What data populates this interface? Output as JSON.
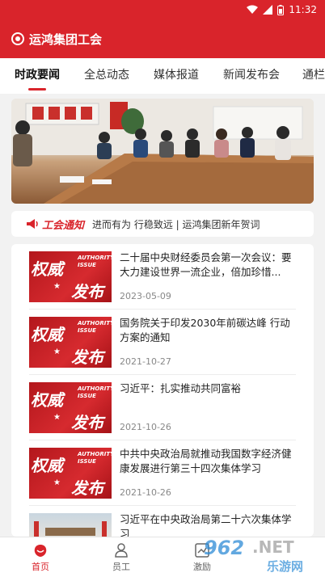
{
  "status": {
    "time": "11:32"
  },
  "header": {
    "title": "运鸿集团工会"
  },
  "tabs": [
    {
      "label": "时政要闻",
      "active": true
    },
    {
      "label": "全总动态",
      "active": false
    },
    {
      "label": "媒体报道",
      "active": false
    },
    {
      "label": "新闻发布会",
      "active": false
    },
    {
      "label": "通栏广",
      "active": false
    }
  ],
  "notice": {
    "label": "工会通知",
    "text": "进而有为 行稳致远 | 运鸿集团新年贺词"
  },
  "news": [
    {
      "title": "二十届中央财经委员会第一次会议：要大力建设世界一流企业，倍加珍惜...",
      "date": "2023-05-09",
      "thumb_text_1": "权威",
      "thumb_text_2": "发布",
      "thumb_en": "AUTHORITY ISSUE"
    },
    {
      "title": "国务院关于印发2030年前碳达峰 行动方案的通知",
      "date": "2021-10-27",
      "thumb_text_1": "权威",
      "thumb_text_2": "发布",
      "thumb_en": "AUTHORITY ISSUE"
    },
    {
      "title": "习近平：扎实推动共同富裕",
      "date": "2021-10-26",
      "thumb_text_1": "权威",
      "thumb_text_2": "发布",
      "thumb_en": "AUTHORITY ISSUE"
    },
    {
      "title": "中共中央政治局就推动我国数字经济健康发展进行第三十四次集体学习",
      "date": "2021-10-26",
      "thumb_text_1": "权威",
      "thumb_text_2": "发布",
      "thumb_en": "AUTHORITY ISSUE"
    },
    {
      "title": "习近平在中央政治局第二十六次集体学习",
      "date": ""
    }
  ],
  "bottom_nav": [
    {
      "label": "首页",
      "icon": "home-icon",
      "active": true
    },
    {
      "label": "员工",
      "icon": "user-icon",
      "active": false
    },
    {
      "label": "激励",
      "icon": "chart-icon",
      "active": false
    }
  ],
  "watermark": {
    "text_1": "962",
    "text_2": ".NET",
    "text_3": "乐游网"
  },
  "colors": {
    "accent": "#d9242b"
  }
}
